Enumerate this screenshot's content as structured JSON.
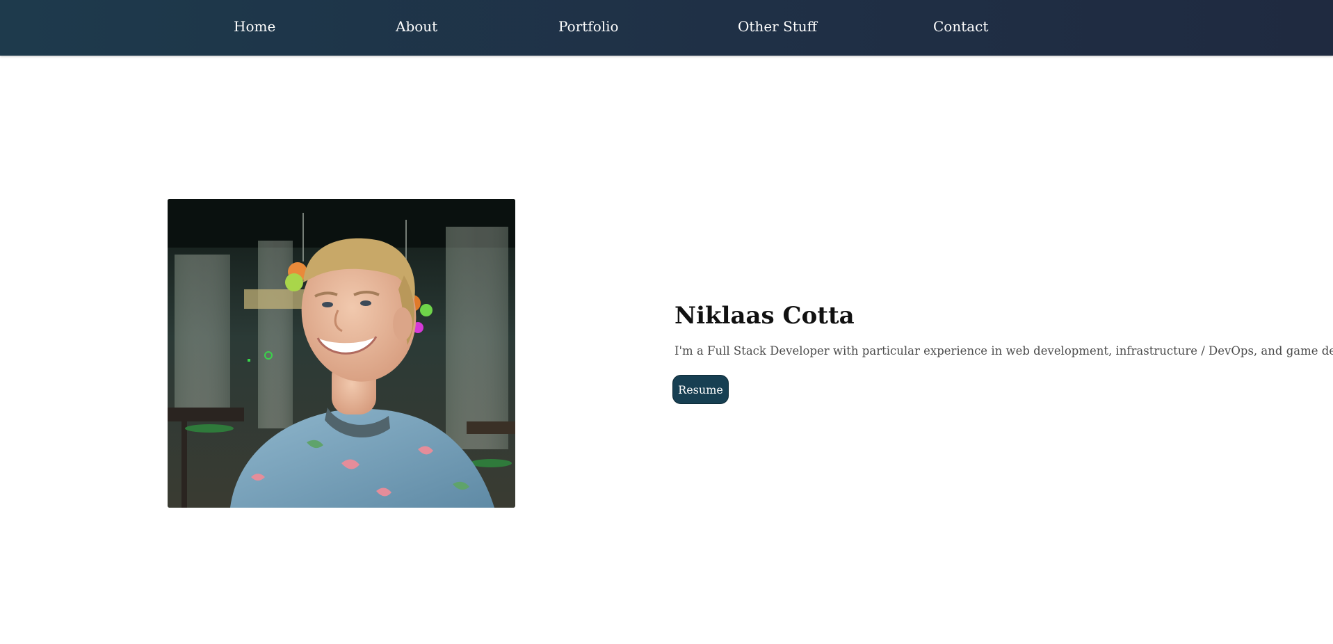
{
  "nav": {
    "items": [
      {
        "label": "Home"
      },
      {
        "label": "About"
      },
      {
        "label": "Portfolio"
      },
      {
        "label": "Other Stuff"
      },
      {
        "label": "Contact"
      }
    ],
    "bg_gradient": [
      "#1e3a4c",
      "#1f2a40"
    ]
  },
  "hero": {
    "name": "Niklaas Cotta",
    "tagline": "I'm a Full Stack Developer with particular experience in web development, infrastructure / DevOps, and game design.",
    "resume_label": "Resume",
    "button_color": "#173f52"
  }
}
